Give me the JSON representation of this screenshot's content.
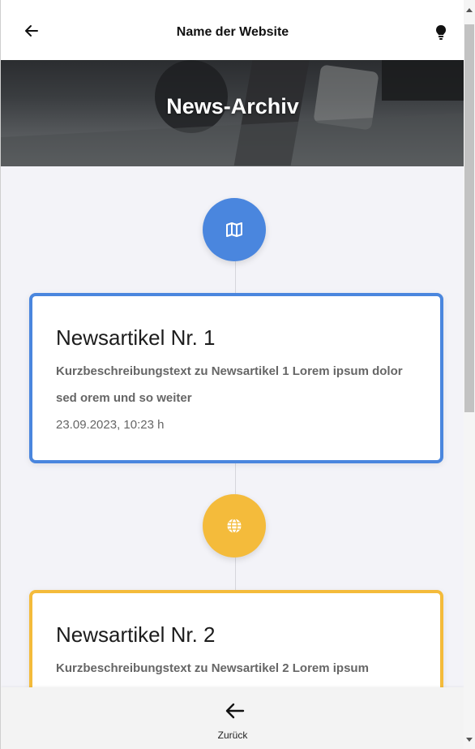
{
  "header": {
    "title": "Name der Website",
    "back_icon": "arrow-left-icon",
    "theme_icon": "lightbulb-icon"
  },
  "hero": {
    "heading": "News-Archiv"
  },
  "timeline": [
    {
      "icon": "map-icon",
      "color": "#4a86de",
      "title": "Newsartikel Nr. 1",
      "description": "Kurzbeschreibungstext zu Newsartikel 1 Lorem ipsum dolor sed orem und so weiter",
      "date": "23.09.2023, 10:23 h"
    },
    {
      "icon": "globe-icon",
      "color": "#f4bb3b",
      "title": "Newsartikel Nr. 2",
      "description": "Kurzbeschreibungstext zu Newsartikel 2 Lorem ipsum"
    }
  ],
  "footer": {
    "back_label": "Zurück",
    "back_icon": "arrow-left-icon"
  },
  "colors": {
    "accent_blue": "#4a86de",
    "accent_yellow": "#f4bb3b",
    "background": "#f3f3f8"
  }
}
